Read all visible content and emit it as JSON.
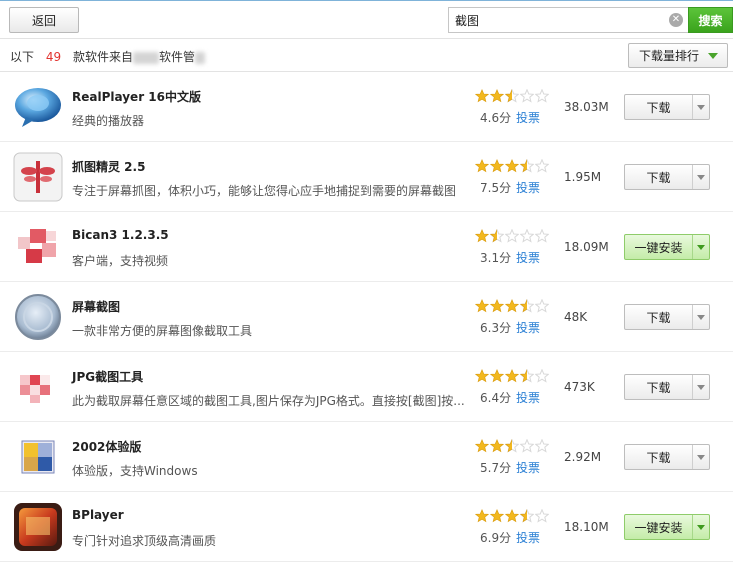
{
  "toolbar": {
    "back_label": "返回",
    "search_value": "截图",
    "search_label": "搜索",
    "clear_icon": "close-circle-icon"
  },
  "summary": {
    "prefix": "以下",
    "count": "49",
    "middle": "款软件来自",
    "suffix": "软件管",
    "sort_label": "下载量排行"
  },
  "apps": [
    {
      "name": "RealPlayer 16中文版",
      "desc": "经典的播放器",
      "stars": 2.5,
      "score": "4.6分",
      "vote": "投票",
      "size": "38.03M",
      "action": "下载",
      "install": false
    },
    {
      "name": "抓图精灵 2.5",
      "desc": "专注于屏幕抓图，体积小巧，能够让您得心应手地捕捉到需要的屏幕截图",
      "stars": 3.5,
      "score": "7.5分",
      "vote": "投票",
      "size": "1.95M",
      "action": "下载",
      "install": false
    },
    {
      "name": "Bican3 1.2.3.5",
      "desc": "客户端，支持视频",
      "stars": 1.5,
      "score": "3.1分",
      "vote": "投票",
      "size": "18.09M",
      "action": "一键安装",
      "install": true
    },
    {
      "name": "屏幕截图",
      "desc": "一款非常方便的屏幕图像截取工具",
      "stars": 3.5,
      "score": "6.3分",
      "vote": "投票",
      "size": "48K",
      "action": "下载",
      "install": false
    },
    {
      "name": "JPG截图工具",
      "desc": "此为截取屏幕任意区域的截图工具,图片保存为JPG格式。直接按[截图]按...",
      "stars": 3.5,
      "score": "6.4分",
      "vote": "投票",
      "size": "473K",
      "action": "下载",
      "install": false
    },
    {
      "name": "2002体验版",
      "desc": "体验版，支持Windows",
      "stars": 2.5,
      "score": "5.7分",
      "vote": "投票",
      "size": "2.92M",
      "action": "下载",
      "install": false
    },
    {
      "name": "BPlayer",
      "desc": "专门针对追求顶级高清画质",
      "stars": 3.5,
      "score": "6.9分",
      "vote": "投票",
      "size": "18.10M",
      "action": "一键安装",
      "install": true
    }
  ],
  "colors": {
    "accent": "#3aa31c",
    "count": "#e2332f",
    "link": "#2a7fd4",
    "star": "#f2b81f",
    "star_empty": "#d8d8d8"
  }
}
